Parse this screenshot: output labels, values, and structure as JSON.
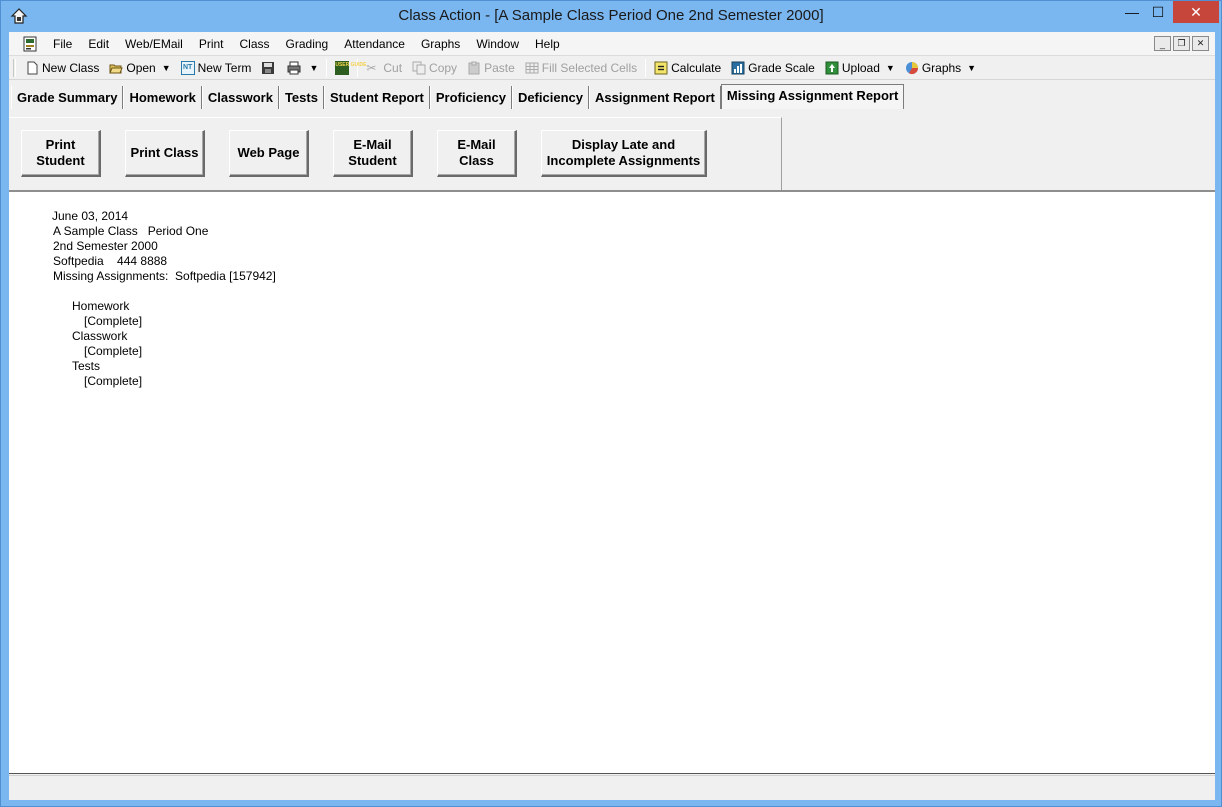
{
  "window": {
    "title": "Class Action - [A Sample Class Period One 2nd Semester 2000]",
    "caption_buttons": {
      "minimize": "—",
      "maximize": "☐",
      "close": "✕"
    }
  },
  "menu": {
    "items": [
      "File",
      "Edit",
      "Web/EMail",
      "Print",
      "Class",
      "Grading",
      "Attendance",
      "Graphs",
      "Window",
      "Help"
    ],
    "mdi": {
      "minimize": "_",
      "restore": "❐",
      "close": "✕"
    }
  },
  "toolbar": {
    "new_class": "New Class",
    "open": "Open",
    "new_term": "New Term",
    "new_term_icon_text": "NT",
    "user_guide_icon_text": "USER GUIDE",
    "cut": "Cut",
    "copy": "Copy",
    "paste": "Paste",
    "fill_selected_cells": "Fill Selected Cells",
    "calculate": "Calculate",
    "grade_scale": "Grade Scale",
    "upload": "Upload",
    "graphs": "Graphs"
  },
  "tabs": [
    {
      "label": "Grade Summary",
      "active": false
    },
    {
      "label": "Homework",
      "active": false
    },
    {
      "label": "Classwork",
      "active": false
    },
    {
      "label": "Tests",
      "active": false
    },
    {
      "label": "Student Report",
      "active": false
    },
    {
      "label": "Proficiency",
      "active": false
    },
    {
      "label": "Deficiency",
      "active": false
    },
    {
      "label": "Assignment Report",
      "active": false
    },
    {
      "label": "Missing Assignment Report",
      "active": true
    }
  ],
  "buttons": {
    "print_student": "Print\nStudent",
    "print_class": "Print Class",
    "web_page": "Web Page",
    "email_student": "E-Mail\nStudent",
    "email_class": "E-Mail\nClass",
    "display_late": "Display Late and\nIncomplete Assignments"
  },
  "report": {
    "date": "June 03, 2014",
    "class_line": "A Sample Class   Period One",
    "semester": "2nd Semester 2000",
    "school_line": "Softpedia    444 8888",
    "missing_line": "Missing Assignments:  Softpedia [157942]",
    "sections": [
      {
        "name": "Homework",
        "status": "[Complete]"
      },
      {
        "name": "Classwork",
        "status": "[Complete]"
      },
      {
        "name": "Tests",
        "status": "[Complete]"
      }
    ]
  }
}
